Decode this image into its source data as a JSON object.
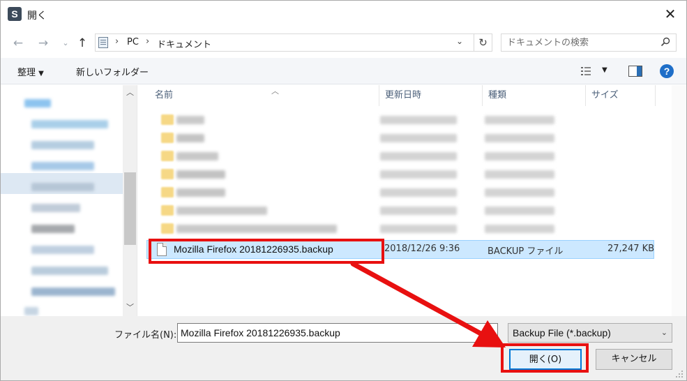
{
  "window": {
    "title": "開く",
    "app_icon_letter": "S"
  },
  "nav": {
    "breadcrumbs": [
      "PC",
      "ドキュメント"
    ],
    "search_placeholder": "ドキュメントの検索"
  },
  "toolbar": {
    "organize_label": "整理",
    "new_folder_label": "新しいフォルダー"
  },
  "columns": {
    "name": "名前",
    "date": "更新日時",
    "type": "種類",
    "size": "サイズ"
  },
  "selected_file": {
    "name": "Mozilla Firefox 20181226935.backup",
    "date": "2018/12/26 9:36",
    "type": "BACKUP ファイル",
    "size": "27,247 KB"
  },
  "bottom": {
    "filename_label": "ファイル名(N):",
    "filename_value": "Mozilla Firefox 20181226935.backup",
    "filter_value": "Backup File (*.backup)",
    "open_button": "開く(O)",
    "cancel_button": "キャンセル"
  },
  "colors": {
    "annotation_red": "#e81010",
    "selection_blue": "#cce8ff",
    "accent_blue": "#0078d7"
  }
}
